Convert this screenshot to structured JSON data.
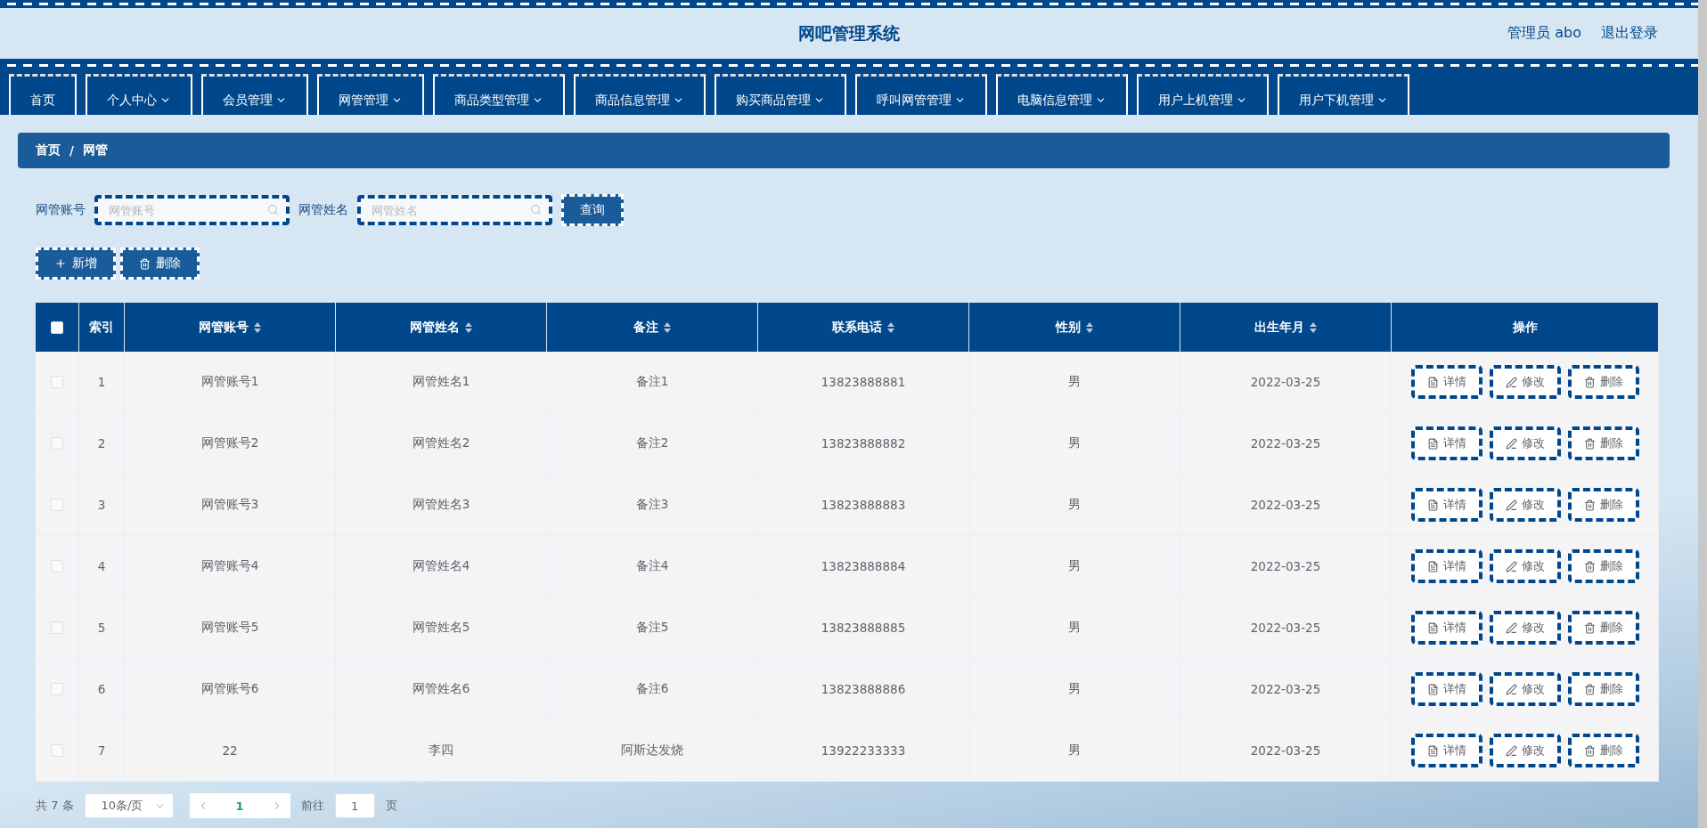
{
  "header": {
    "title": "网吧管理系统",
    "user": "管理员 abo",
    "logout": "退出登录"
  },
  "nav": [
    {
      "label": "首页",
      "kind": "link"
    },
    {
      "label": "个人中心",
      "kind": "menu"
    },
    {
      "label": "会员管理",
      "kind": "menu"
    },
    {
      "label": "网管管理",
      "kind": "menu"
    },
    {
      "label": "商品类型管理",
      "kind": "menu"
    },
    {
      "label": "商品信息管理",
      "kind": "menu"
    },
    {
      "label": "购买商品管理",
      "kind": "menu"
    },
    {
      "label": "呼叫网管管理",
      "kind": "menu"
    },
    {
      "label": "电脑信息管理",
      "kind": "menu"
    },
    {
      "label": "用户上机管理",
      "kind": "menu"
    },
    {
      "label": "用户下机管理",
      "kind": "menu"
    }
  ],
  "breadcrumb": [
    "首页",
    "网管"
  ],
  "breadcrumb_separator": "/",
  "search": {
    "fields": [
      {
        "label": "网管账号",
        "placeholder": "网管账号"
      },
      {
        "label": "网管姓名",
        "placeholder": "网管姓名"
      }
    ],
    "button": "查询"
  },
  "actions": [
    {
      "label": "新增",
      "kind": "add"
    },
    {
      "label": "删除",
      "kind": "delete"
    }
  ],
  "table": {
    "select_all": {
      "checked": false
    },
    "columns": [
      {
        "label": "索引",
        "sortable": false
      },
      {
        "label": "网管账号",
        "sortable": true
      },
      {
        "label": "网管姓名",
        "sortable": true
      },
      {
        "label": "备注",
        "sortable": true
      },
      {
        "label": "联系电话",
        "sortable": true
      },
      {
        "label": "性别",
        "sortable": true
      },
      {
        "label": "出生年月",
        "sortable": true
      },
      {
        "label": "操作",
        "sortable": false
      }
    ],
    "rows": [
      {
        "checked": false,
        "cells": [
          "1",
          "网管账号1",
          "网管姓名1",
          "备注1",
          "13823888881",
          "男",
          "2022-03-25"
        ],
        "actions": [
          {
            "label": "详情",
            "kind": "detail"
          },
          {
            "label": "修改",
            "kind": "edit"
          },
          {
            "label": "删除",
            "kind": "delete"
          }
        ]
      },
      {
        "checked": false,
        "cells": [
          "2",
          "网管账号2",
          "网管姓名2",
          "备注2",
          "13823888882",
          "男",
          "2022-03-25"
        ],
        "actions": [
          {
            "label": "详情",
            "kind": "detail"
          },
          {
            "label": "修改",
            "kind": "edit"
          },
          {
            "label": "删除",
            "kind": "delete"
          }
        ]
      },
      {
        "checked": false,
        "cells": [
          "3",
          "网管账号3",
          "网管姓名3",
          "备注3",
          "13823888883",
          "男",
          "2022-03-25"
        ],
        "actions": [
          {
            "label": "详情",
            "kind": "detail"
          },
          {
            "label": "修改",
            "kind": "edit"
          },
          {
            "label": "删除",
            "kind": "delete"
          }
        ]
      },
      {
        "checked": false,
        "cells": [
          "4",
          "网管账号4",
          "网管姓名4",
          "备注4",
          "13823888884",
          "男",
          "2022-03-25"
        ],
        "actions": [
          {
            "label": "详情",
            "kind": "detail"
          },
          {
            "label": "修改",
            "kind": "edit"
          },
          {
            "label": "删除",
            "kind": "delete"
          }
        ]
      },
      {
        "checked": false,
        "cells": [
          "5",
          "网管账号5",
          "网管姓名5",
          "备注5",
          "13823888885",
          "男",
          "2022-03-25"
        ],
        "actions": [
          {
            "label": "详情",
            "kind": "detail"
          },
          {
            "label": "修改",
            "kind": "edit"
          },
          {
            "label": "删除",
            "kind": "delete"
          }
        ]
      },
      {
        "checked": false,
        "cells": [
          "6",
          "网管账号6",
          "网管姓名6",
          "备注6",
          "13823888886",
          "男",
          "2022-03-25"
        ],
        "actions": [
          {
            "label": "详情",
            "kind": "detail"
          },
          {
            "label": "修改",
            "kind": "edit"
          },
          {
            "label": "删除",
            "kind": "delete"
          }
        ]
      },
      {
        "checked": false,
        "cells": [
          "7",
          "22",
          "李四",
          "阿斯达发烧",
          "13922233333",
          "男",
          "2022-03-25"
        ],
        "actions": [
          {
            "label": "详情",
            "kind": "detail"
          },
          {
            "label": "修改",
            "kind": "edit"
          },
          {
            "label": "删除",
            "kind": "delete"
          }
        ]
      }
    ]
  },
  "pagination": {
    "total": "共 7 条",
    "page_size": "10条/页",
    "pages": [
      {
        "label": "1",
        "selected": true
      }
    ],
    "goto_label": "前往",
    "goto_value": "1",
    "goto_suffix": "页"
  }
}
